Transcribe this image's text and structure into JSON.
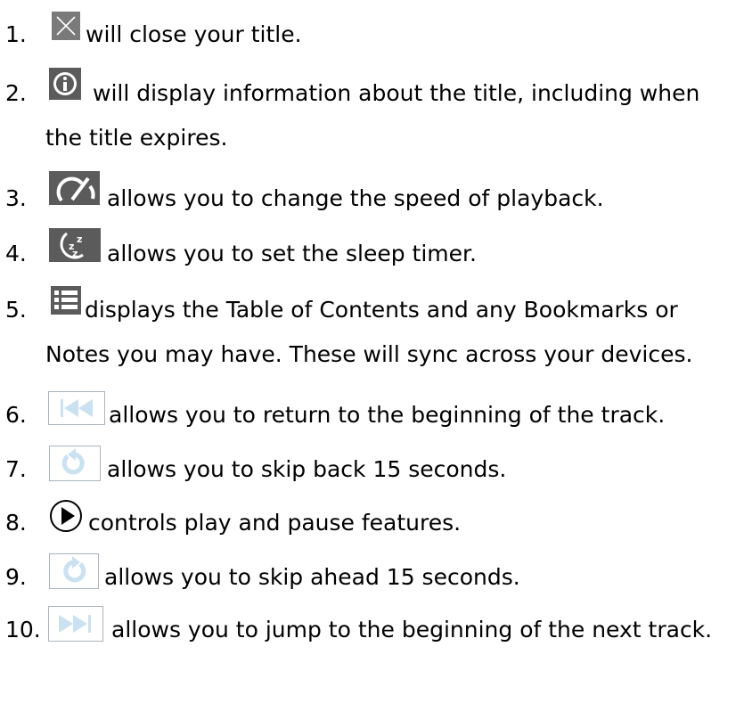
{
  "instructions": [
    {
      "number": "1.",
      "icon": "close-icon",
      "text": "will close your title."
    },
    {
      "number": "2.",
      "icon": "info-icon",
      "line1": "will display information about the title, including when",
      "line2": "the title expires."
    },
    {
      "number": "3.",
      "icon": "speed-gauge-icon",
      "text": "allows you to change the speed of playback."
    },
    {
      "number": "4.",
      "icon": "sleep-timer-icon",
      "text": "allows you to set the sleep timer."
    },
    {
      "number": "5.",
      "icon": "table-of-contents-icon",
      "line1": "displays the Table of Contents and any Bookmarks or",
      "line2": "Notes you may have. These will sync across your devices."
    },
    {
      "number": "6.",
      "icon": "previous-track-icon",
      "text": "allows you to return to the beginning of the track."
    },
    {
      "number": "7.",
      "icon": "skip-back-icon",
      "text": "allows you to skip back 15 seconds."
    },
    {
      "number": "8.",
      "icon": "play-icon",
      "text": "controls play and pause features."
    },
    {
      "number": "9.",
      "icon": "skip-forward-icon",
      "text": "allows you to skip ahead 15 seconds."
    },
    {
      "number": "10.",
      "icon": "next-track-icon",
      "text": "allows you to jump to the beginning of the next track."
    }
  ],
  "colors": {
    "dark_icon_bg": "#5b5b5b",
    "light_icon_fill": "#c9e1f1",
    "light_icon_border": "#aab4bc",
    "text": "#000000"
  }
}
